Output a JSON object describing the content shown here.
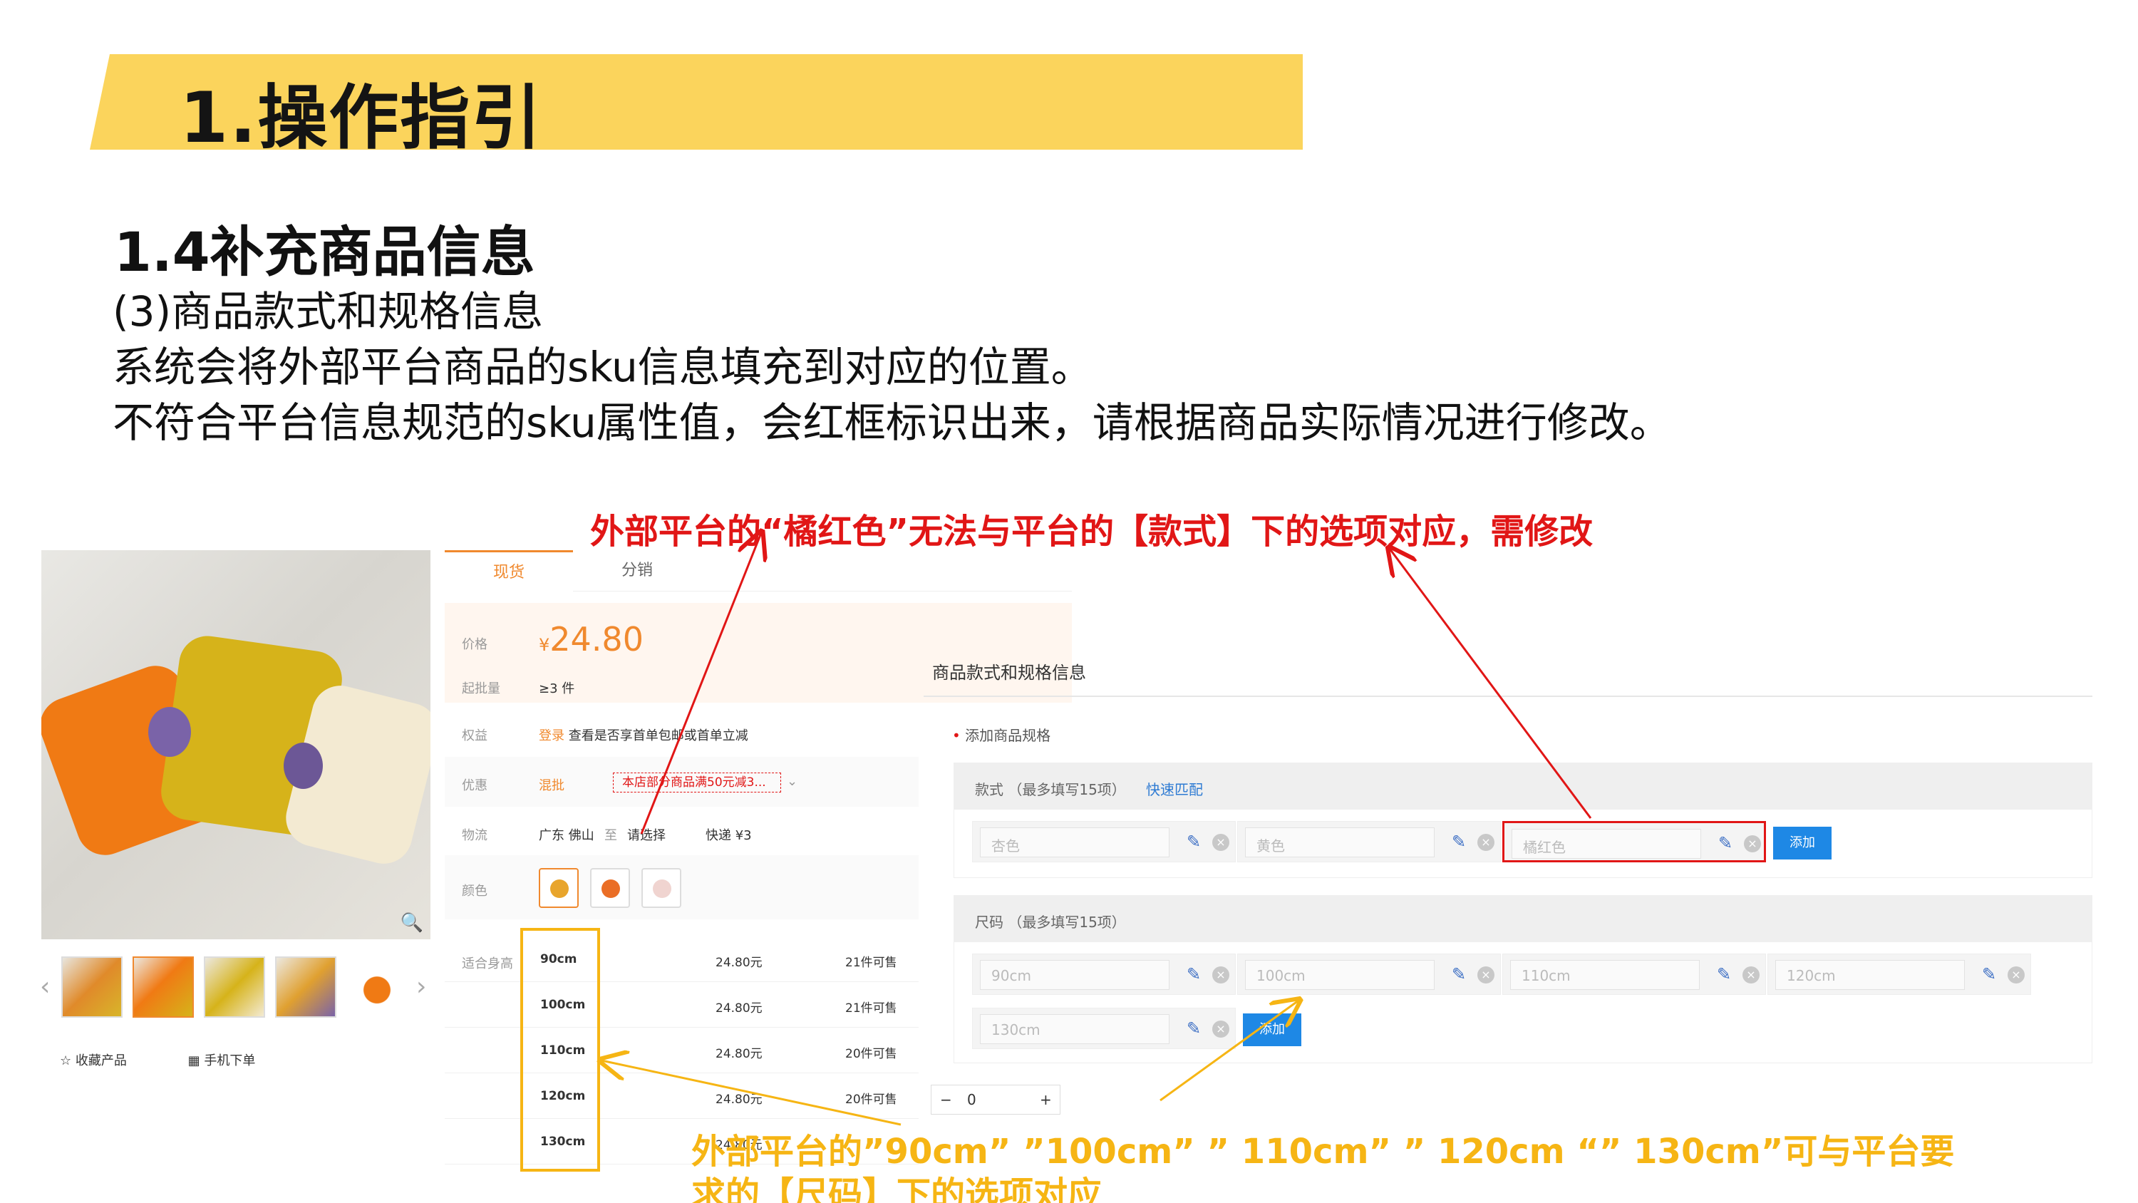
{
  "header": {
    "title": "1.操作指引"
  },
  "section": {
    "title": "1.4补充商品信息",
    "lines": [
      "(3)商品款式和规格信息",
      "系统会将外部平台商品的sku信息填充到对应的位置。",
      "不符合平台信息规范的sku属性值，会红框标识出来，请根据商品实际情况进行修改。"
    ]
  },
  "annotations": {
    "red": "外部平台的“橘红色”无法与平台的【款式】下的选项对应，需修改",
    "yellow_line1": "外部平台的”90cm” ”100cm” ” 110cm” ” 120cm “” 130cm”可与平台要",
    "yellow_line2": "求的【尺码】下的选项对应"
  },
  "product": {
    "tabs": [
      "现货",
      "分销"
    ],
    "price_label": "价格",
    "currency": "¥",
    "price": "24.80",
    "moq_label": "起批量",
    "moq": "≥3 件",
    "benefit_label": "权益",
    "benefit_login": "登录",
    "benefit_text": "查看是否享首单包邮或首单立减",
    "promo_label": "优惠",
    "promo_tag": "混批",
    "promo_coupon": "本店部分商品满50元减3...",
    "logistics_label": "物流",
    "logistics_from": "广东 佛山",
    "logistics_to_word": "至",
    "logistics_select": "请选择",
    "logistics_fee": "快递 ¥3",
    "color_label": "颜色",
    "size_label": "适合身高",
    "sizes": [
      {
        "size": "90cm",
        "price": "24.80元",
        "stock": "21件可售"
      },
      {
        "size": "100cm",
        "price": "24.80元",
        "stock": "21件可售"
      },
      {
        "size": "110cm",
        "price": "24.80元",
        "stock": "20件可售"
      },
      {
        "size": "120cm",
        "price": "24.80元",
        "stock": "20件可售"
      },
      {
        "size": "130cm",
        "price": "24.80元",
        "stock": ""
      }
    ],
    "qty_minus": "−",
    "qty_value": "0",
    "qty_plus": "+",
    "fav": "收藏产品",
    "mobile_order": "手机下单"
  },
  "spec_form": {
    "title": "商品款式和规格信息",
    "add_spec": "添加商品规格",
    "required_mark": "•",
    "style_group": {
      "label": "款式 （最多填写15项）",
      "match_link": "快速匹配",
      "options": [
        "杏色",
        "黄色",
        "橘红色"
      ]
    },
    "size_group": {
      "label": "尺码 （最多填写15项）",
      "options": [
        "90cm",
        "100cm",
        "110cm",
        "120cm",
        "130cm"
      ]
    },
    "add_label": "添加"
  },
  "colors": {
    "banner": "#fbd45c",
    "red": "#e11616",
    "yellow": "#f6b514",
    "orange": "#f0892e",
    "blue": "#1e88e5"
  },
  "icons": [
    "search-icon",
    "star-icon",
    "qr-icon",
    "pencil-icon",
    "delete-icon",
    "chevron-left-icon",
    "chevron-right-icon",
    "chevron-down-icon"
  ]
}
